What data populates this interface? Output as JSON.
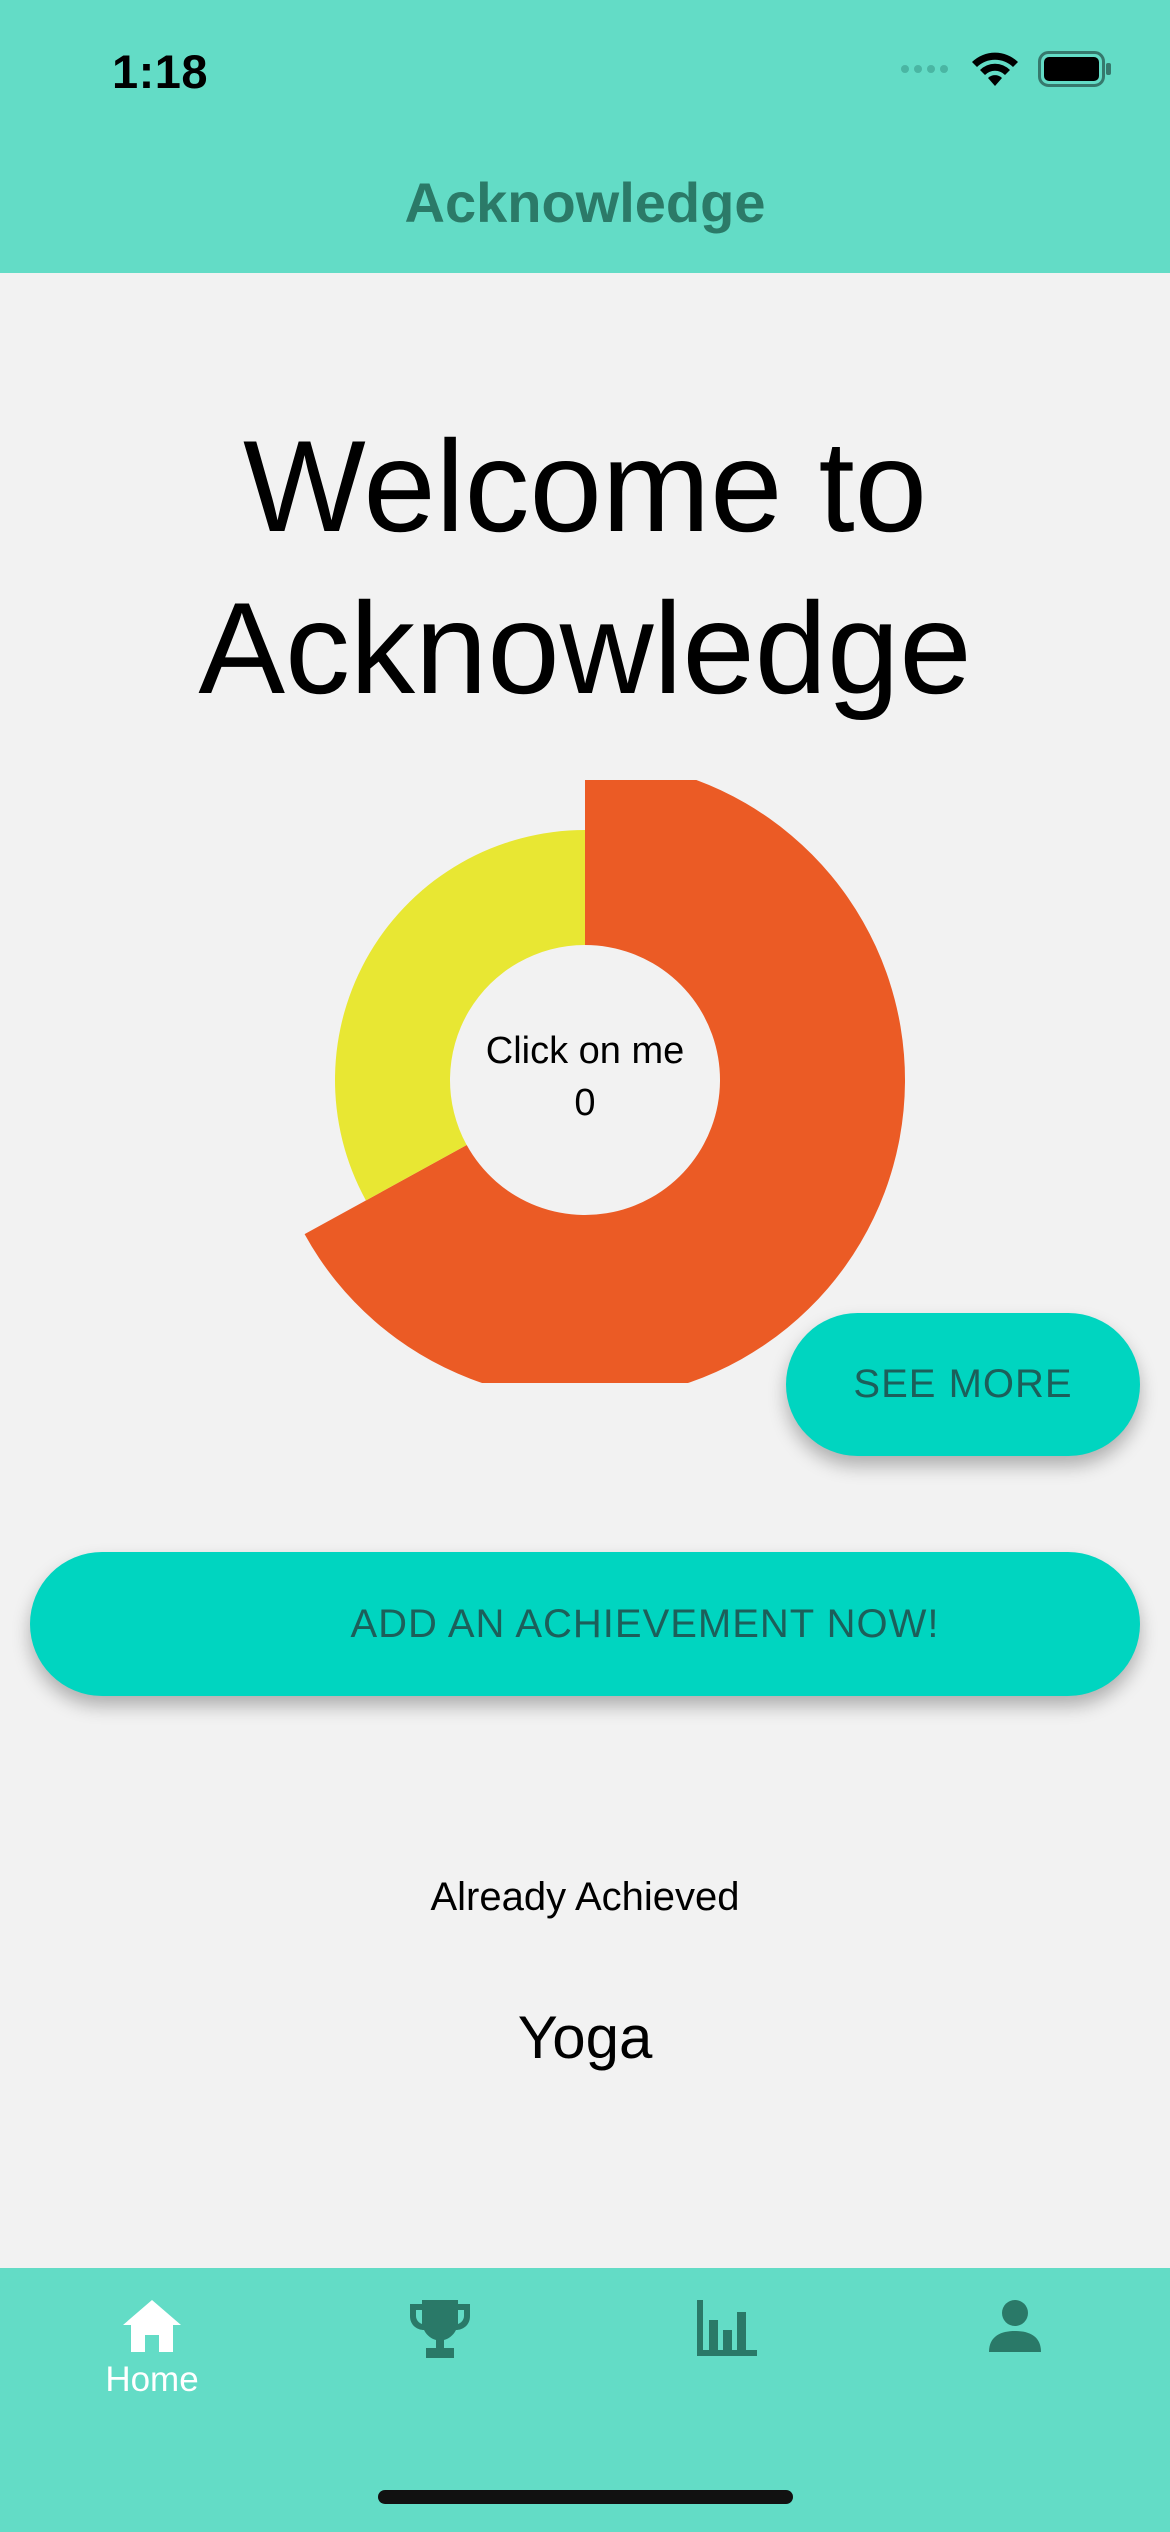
{
  "status_bar": {
    "time": "1:18"
  },
  "header": {
    "title": "Acknowledge"
  },
  "main": {
    "welcome_line1": "Welcome to",
    "welcome_line2": "Acknowledge",
    "chart": {
      "center_label": "Click on me",
      "center_value": "0",
      "segments": [
        {
          "color": "#eb5b25",
          "share": 0.67
        },
        {
          "color": "#e8e733",
          "share": 0.33
        }
      ]
    },
    "see_more_label": "SEE MORE",
    "add_achievement_label": "ADD AN ACHIEVEMENT NOW!",
    "already_achieved_label": "Already Achieved",
    "achievements": [
      "Yoga"
    ]
  },
  "tab_bar": {
    "tabs": [
      {
        "label": "Home",
        "icon": "home-icon",
        "active": true
      },
      {
        "label": "",
        "icon": "trophy-icon",
        "active": false
      },
      {
        "label": "",
        "icon": "bar-chart-icon",
        "active": false
      },
      {
        "label": "",
        "icon": "person-icon",
        "active": false
      }
    ]
  },
  "colors": {
    "header_bg": "#63dcc6",
    "title_text": "#2b7a68",
    "button_bg": "#00d5c0",
    "button_text": "#1c5f5a",
    "page_bg": "#f2f2f2",
    "chart_orange": "#eb5b25",
    "chart_yellow": "#e8e733"
  }
}
